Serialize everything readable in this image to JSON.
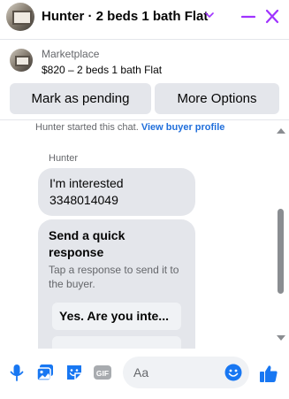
{
  "header": {
    "title": "Hunter · 2 beds 1 bath Flat"
  },
  "listing": {
    "source": "Marketplace",
    "price_line": "$820 – 2 beds 1 bath Flat"
  },
  "actions": {
    "mark_pending_label": "Mark as pending",
    "more_options_label": "More Options"
  },
  "chat": {
    "notice_text": "Hunter started this chat.",
    "notice_link": "View buyer profile",
    "sender_name": "Hunter",
    "message_line1": "I'm interested",
    "message_line2": "3348014049",
    "quick_response": {
      "title": "Send a quick response",
      "subtitle": "Tap a response to send it to the buyer.",
      "options": [
        "Yes. Are you inte..."
      ]
    }
  },
  "composer": {
    "placeholder": "Aa",
    "gif_label": "GIF"
  },
  "colors": {
    "accent": "#1877f2",
    "header_icons": "#a033ff",
    "link": "#216fdb",
    "button_bg": "#e4e6eb"
  },
  "icons": {
    "header": [
      "chevron-down-icon",
      "minimize-icon",
      "close-icon"
    ],
    "composer": [
      "microphone-icon",
      "image-icon",
      "sticker-icon",
      "gif-icon",
      "emoji-icon",
      "like-icon"
    ]
  }
}
